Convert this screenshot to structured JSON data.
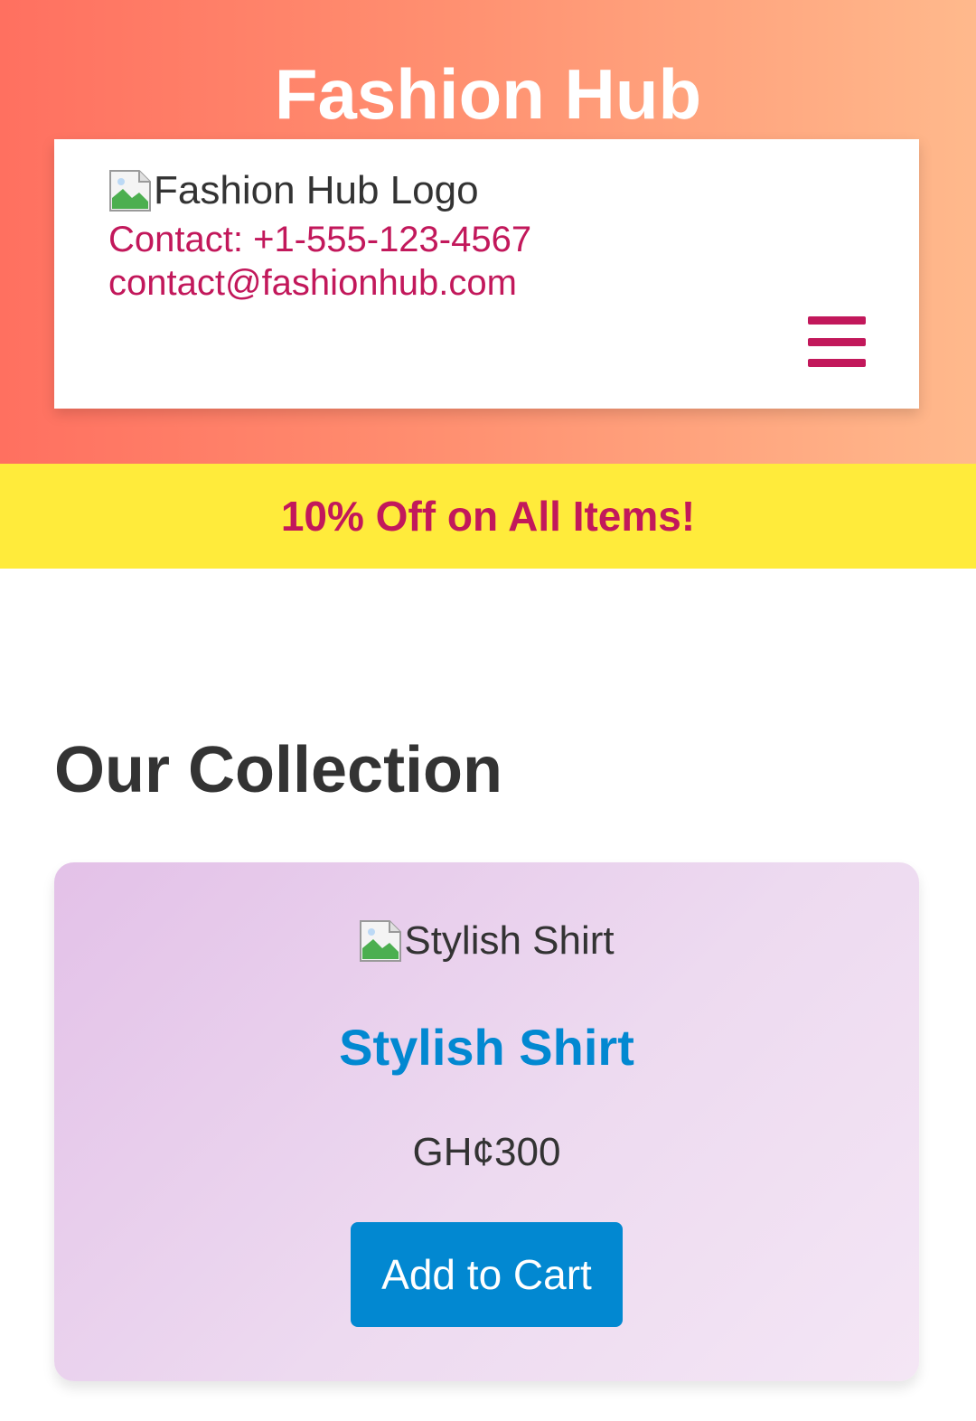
{
  "site": {
    "title": "Fashion Hub",
    "logo_alt": "Fashion Hub Logo",
    "contact_phone": "Contact: +1-555-123-4567",
    "contact_email": "contact@fashionhub.com",
    "menu_icon": "hamburger-menu-icon"
  },
  "promo": {
    "text": "10% Off on All Items!"
  },
  "collection": {
    "title": "Our Collection",
    "products": [
      {
        "image_alt": "Stylish Shirt",
        "name": "Stylish Shirt",
        "price": "GH¢300",
        "button_label": "Add to Cart"
      }
    ]
  },
  "colors": {
    "accent_pink": "#c2185b",
    "promo_yellow": "#ffeb3b",
    "button_blue": "#0288d1",
    "hero_gradient_start": "#ff7060",
    "hero_gradient_end": "#ffb98c"
  }
}
